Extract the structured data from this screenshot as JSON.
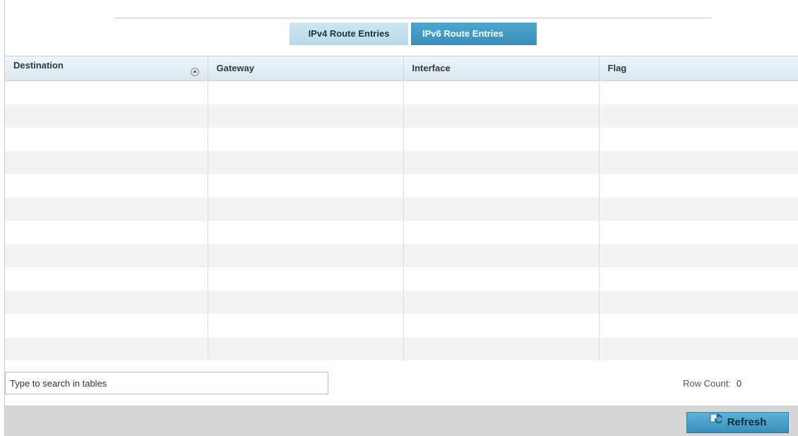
{
  "tabs": [
    {
      "label": "IPv4 Route Entries",
      "active": false
    },
    {
      "label": "IPv6 Route Entries",
      "active": true
    }
  ],
  "table": {
    "columns": [
      "Destination",
      "Gateway",
      "Interface",
      "Flag"
    ],
    "sort_column": "Destination",
    "rows": []
  },
  "search": {
    "placeholder": "Type to search in tables",
    "value": ""
  },
  "row_count": {
    "label": "Row Count:",
    "value": "0"
  },
  "footer": {
    "refresh_label": "Refresh"
  },
  "colors": {
    "tab_active": "#3a8fbb",
    "tab_inactive": "#c5e0eb",
    "footer_bg": "#d6d6d6"
  }
}
